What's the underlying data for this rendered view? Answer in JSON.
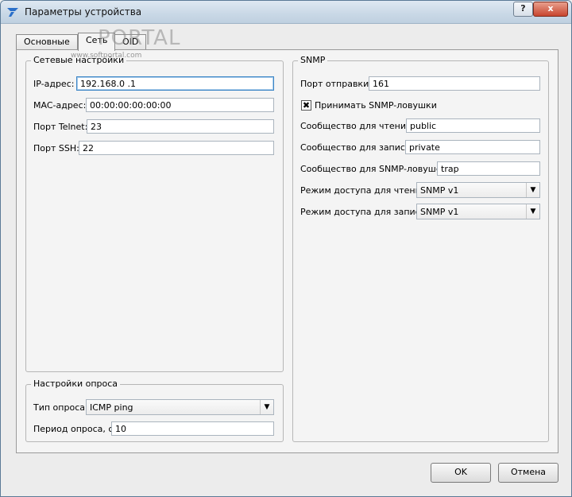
{
  "window": {
    "title": "Параметры устройства"
  },
  "tabs": [
    {
      "label": "Основные"
    },
    {
      "label": "Сеть"
    },
    {
      "label": "OID"
    }
  ],
  "watermark": {
    "text": "PORTAL",
    "sub": "www.softportal.com"
  },
  "network": {
    "title": "Сетевые настройки",
    "ip_label": "IP-адрес:",
    "ip_value": "192.168.0  .1",
    "mac_label": "MAC-адрес:",
    "mac_value": "00:00:00:00:00:00",
    "telnet_label": "Порт Telnet:",
    "telnet_value": "23",
    "ssh_label": "Порт SSH:",
    "ssh_value": "22"
  },
  "poll": {
    "title": "Настройки опроса",
    "type_label": "Тип опроса:",
    "type_value": "ICMP ping",
    "period_label": "Период опроса, с:",
    "period_value": "10"
  },
  "snmp": {
    "title": "SNMP",
    "port_label": "Порт отправки:",
    "port_value": "161",
    "accept_traps_label": "Принимать SNMP-ловушки",
    "accept_traps_checked": true,
    "read_comm_label": "Сообщество для чтения:",
    "read_comm_value": "public",
    "write_comm_label": "Сообщество для записи:",
    "write_comm_value": "private",
    "trap_comm_label": "Сообщество для SNMP-ловушек:",
    "trap_comm_value": "trap",
    "read_mode_label": "Режим доступа для чтения:",
    "read_mode_value": "SNMP v1",
    "write_mode_label": "Режим доступа для записи:",
    "write_mode_value": "SNMP v1"
  },
  "buttons": {
    "ok": "OK",
    "cancel": "Отмена"
  },
  "titlebar_buttons": {
    "help": "?",
    "close": "x"
  },
  "icons": {
    "app": "app-logo-icon",
    "combo": "chevron-down-icon",
    "check": "✖"
  }
}
